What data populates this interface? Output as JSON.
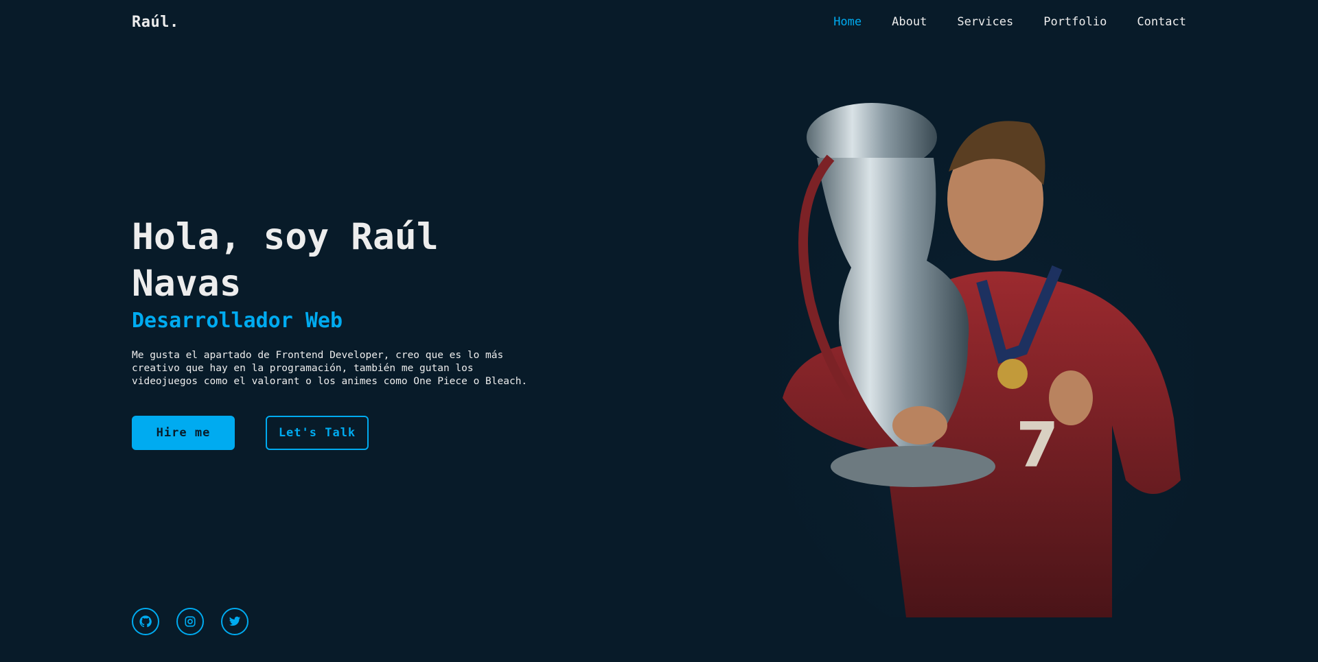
{
  "brand": {
    "logo": "Raúl."
  },
  "nav": {
    "items": [
      {
        "label": "Home",
        "active": true
      },
      {
        "label": "About",
        "active": false
      },
      {
        "label": "Services",
        "active": false
      },
      {
        "label": "Portfolio",
        "active": false
      },
      {
        "label": "Contact",
        "active": false
      }
    ]
  },
  "hero": {
    "title_line1": "Hola, soy Raúl",
    "title_line2": "Navas",
    "subtitle": "Desarrollador Web",
    "description": "Me gusta el apartado de Frontend Developer, creo que es lo más creativo que hay en la programación, también me gutan los videojuegos como el valorant o los animes como One Piece o Bleach.",
    "primary_button": "Hire me",
    "secondary_button": "Let's Talk"
  },
  "social": [
    {
      "icon": "github-icon"
    },
    {
      "icon": "instagram-icon"
    },
    {
      "icon": "twitter-icon"
    }
  ],
  "colors": {
    "background": "#081b29",
    "accent": "#00abf0",
    "text": "#ededed"
  }
}
